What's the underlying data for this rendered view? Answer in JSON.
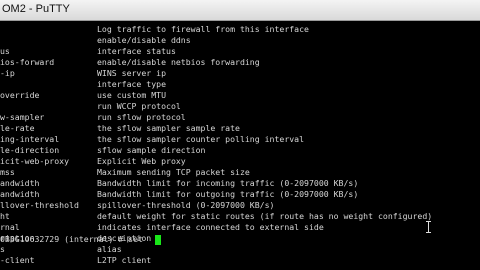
{
  "window": {
    "title": "OM2 - PuTTY"
  },
  "terminal": {
    "rows": [
      {
        "left": "",
        "right": "Log traffic to firewall from this interface"
      },
      {
        "left": "",
        "right": "enable/disable ddns"
      },
      {
        "left": "us",
        "right": "interface status"
      },
      {
        "left": "ios-forward",
        "right": "enable/disable netbios forwarding"
      },
      {
        "left": "-ip",
        "right": "WINS server ip"
      },
      {
        "left": "",
        "right": "interface type"
      },
      {
        "left": "override",
        "right": "use custom MTU"
      },
      {
        "left": "",
        "right": "run WCCP protocol"
      },
      {
        "left": "w-sampler",
        "right": "run sflow protocol"
      },
      {
        "left": "le-rate",
        "right": "the sflow sampler sample rate"
      },
      {
        "left": "ing-interval",
        "right": "the sflow sampler counter polling interval"
      },
      {
        "left": "le-direction",
        "right": "sflow sample direction"
      },
      {
        "left": "icit-web-proxy",
        "right": "Explicit Web proxy"
      },
      {
        "left": "mss",
        "right": "Maximum sending TCP packet size"
      },
      {
        "left": "andwidth",
        "right": "Bandwidth limit for incoming traffic (0-2097000 KB/s)"
      },
      {
        "left": "andwidth",
        "right": "Bandwidth limit for outgoing traffic (0-2097000 KB/s)"
      },
      {
        "left": "llover-threshold",
        "right": "spillover-threshold (0-2097000 KB/s)"
      },
      {
        "left": "ht",
        "right": "default weight for static routes (if route has no weight configured)"
      },
      {
        "left": "rnal",
        "right": "indicates interface connected to external side"
      },
      {
        "left": "ription",
        "right": "description"
      },
      {
        "left": "s",
        "right": "alias"
      },
      {
        "left": "-client",
        "right": "L2TP client"
      }
    ],
    "prompt": "0B3G10632729 (internal) # set "
  }
}
